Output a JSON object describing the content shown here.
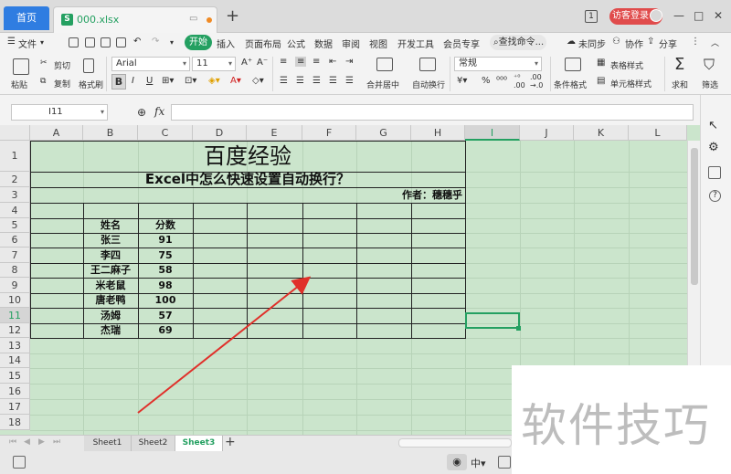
{
  "tabbar": {
    "home_tab": "首页",
    "file_tab": "000.xlsx",
    "file_icon_letter": "S",
    "add_tab": "+",
    "badge_number": "1",
    "login_button": "访客登录",
    "minimize": "—",
    "restore": "□",
    "close": "✕"
  },
  "menubar": {
    "file_menu": "文件",
    "tabs": [
      "开始",
      "插入",
      "页面布局",
      "公式",
      "数据",
      "审阅",
      "视图",
      "开发工具",
      "会员专享"
    ],
    "search": "查找命令...",
    "unsynced": "未同步",
    "collab": "协作",
    "share": "分享"
  },
  "ribbon": {
    "paste": "粘贴",
    "cut": "剪切",
    "copy": "复制",
    "format_painter": "格式刷",
    "font_name": "Arial",
    "font_size": "11",
    "bold": "B",
    "merge_center": "合并居中",
    "wrap_text": "自动换行",
    "number_format": "常规",
    "conditional_format": "条件格式",
    "table_style": "表格样式",
    "cell_style": "单元格样式",
    "sum": "求和",
    "filter": "筛选"
  },
  "formula_bar": {
    "cell_ref": "I11",
    "fx": "fx",
    "formula": ""
  },
  "columns": [
    "A",
    "B",
    "C",
    "D",
    "E",
    "F",
    "G",
    "H",
    "I",
    "J",
    "K",
    "L"
  ],
  "rows": [
    "1",
    "2",
    "3",
    "4",
    "5",
    "6",
    "7",
    "8",
    "9",
    "10",
    "11",
    "12",
    "13",
    "14",
    "15",
    "16",
    "17",
    "18"
  ],
  "sheet": {
    "title": "百度经验",
    "subtitle": "Excel中怎么快速设置自动换行？",
    "author": "作者：穗穗乎",
    "header_name": "姓名",
    "header_score": "分数",
    "records": [
      {
        "name": "张三",
        "score": "91"
      },
      {
        "name": "李四",
        "score": "75"
      },
      {
        "name": "王二麻子",
        "score": "58"
      },
      {
        "name": "米老鼠",
        "score": "98"
      },
      {
        "name": "唐老鸭",
        "score": "100"
      },
      {
        "name": "汤姆",
        "score": "57"
      },
      {
        "name": "杰瑞",
        "score": "69"
      }
    ],
    "selected_column": "I",
    "selected_row": "11",
    "annotation_color": "#e0302a"
  },
  "sheet_tabs": [
    "Sheet1",
    "Sheet2",
    "Sheet3"
  ],
  "active_sheet": "Sheet3",
  "watermark": "软件技巧",
  "colors": {
    "accent": "#24a061",
    "grid_bg": "#cbe5cc",
    "home_tab": "#2f7de1",
    "login": "#e04b4b"
  }
}
